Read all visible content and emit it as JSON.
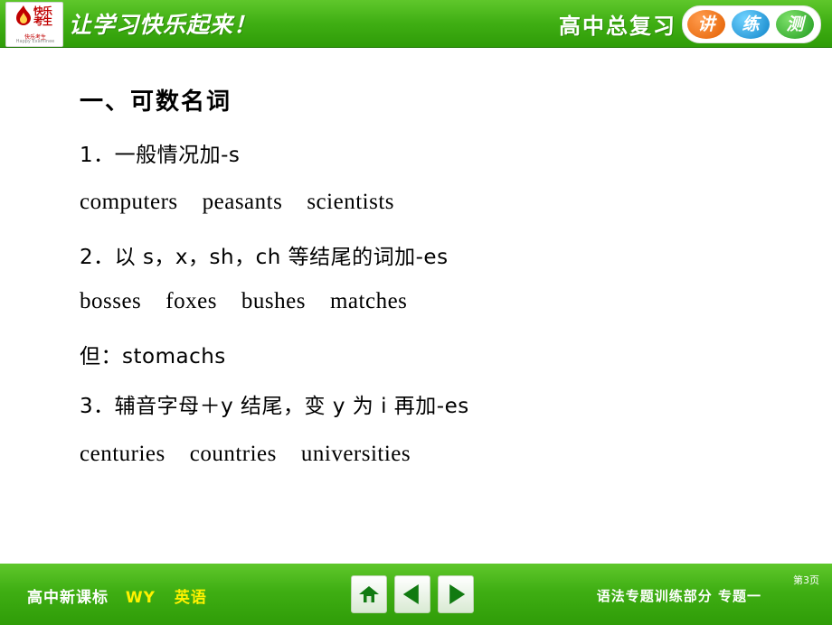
{
  "header": {
    "slogan": "让学习快乐起来！",
    "right_title": "高中总复习",
    "pills": [
      "讲",
      "练",
      "测"
    ],
    "logo": {
      "brand_cn": "快乐",
      "brand_cn2": "考生",
      "sub_cn": "快乐考生",
      "sub_en": "Happy Examinee"
    }
  },
  "main": {
    "heading": "一、可数名词",
    "lines": [
      {
        "text": "1．一般情况加-s",
        "style": "cn"
      },
      {
        "text": "computers    peasants    scientists",
        "style": "en"
      },
      {
        "text": "2．以 s，x，sh，ch 等结尾的词加-es",
        "style": "cn"
      },
      {
        "text": "bosses    foxes    bushes    matches",
        "style": "en"
      },
      {
        "text": "但：stomachs",
        "style": "cn"
      },
      {
        "text": "3．辅音字母＋y 结尾，变 y 为 i 再加-es",
        "style": "cn"
      },
      {
        "text": "centuries    countries    universities",
        "style": "en"
      }
    ]
  },
  "footer": {
    "course": "高中新课标",
    "publisher": "WY",
    "subject": "英语",
    "section": "语法专题训练部分  专题一",
    "page_label": "第3页",
    "nav": {
      "home": "home-button",
      "prev": "previous-slide-button",
      "next": "next-slide-button"
    }
  },
  "colors": {
    "bar_green": "#3fae13",
    "accent_yellow": "#fff200",
    "logo_red": "#c00000"
  }
}
